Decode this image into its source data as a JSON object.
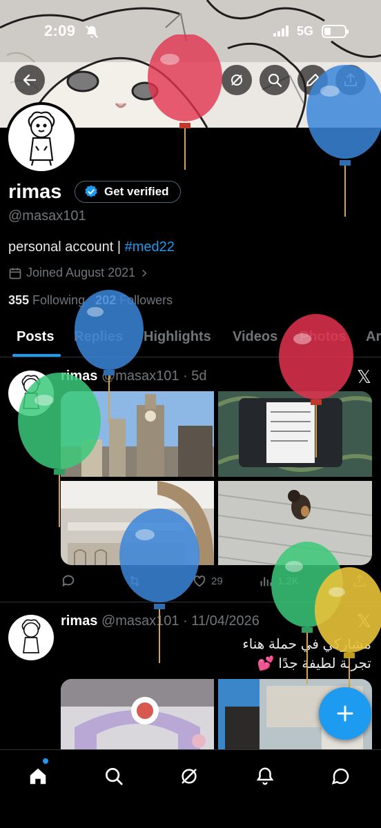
{
  "status_bar": {
    "time": "2:09",
    "network": "5G"
  },
  "banner": {
    "back_label": "back",
    "grok_label": "grok",
    "search_label": "search",
    "edit_label": "edit",
    "share_label": "share"
  },
  "profile": {
    "display_name": "rimas",
    "verify_label": "Get verified",
    "handle": "@masax101",
    "bio_text": "personal account | ",
    "bio_hashtag": "#med22",
    "joined": "Joined August 2021",
    "following_count": "355",
    "following_label": " Following",
    "followers_count": "202",
    "followers_label": " Followers"
  },
  "tabs": [
    "Posts",
    "Replies",
    "Highlights",
    "Videos",
    "Photos",
    "Articles"
  ],
  "tabs_visible": [
    "Posts",
    "Replies",
    "Highlights",
    "Videos",
    "Photos",
    "Ar"
  ],
  "posts": [
    {
      "name": "rimas",
      "meta": "@masax101 · 5d",
      "actions": {
        "replies": "",
        "reposts": "",
        "likes": "29",
        "views": "1.2K"
      }
    },
    {
      "name": "rimas",
      "meta": "@masax101 · 11/04/2026",
      "text_line1": "مشاركي في حملة هناء",
      "text_line2": "تجربة لطيفة جدًا 💕"
    }
  ],
  "icons": {
    "back": "arrow-left-icon",
    "grok": "grok-icon",
    "search": "search-icon",
    "edit": "pencil-icon",
    "share": "share-icon",
    "verified": "verified-badge-icon",
    "calendar": "calendar-icon",
    "x_logo": "x-logo-icon",
    "compose": "plus-icon",
    "nav": [
      "home-icon",
      "search-icon",
      "grok-icon",
      "bell-icon",
      "messages-icon"
    ]
  },
  "colors": {
    "accent": "#1d9bf0",
    "background": "#000000",
    "muted": "#71767b",
    "text": "#e7e9ea"
  }
}
